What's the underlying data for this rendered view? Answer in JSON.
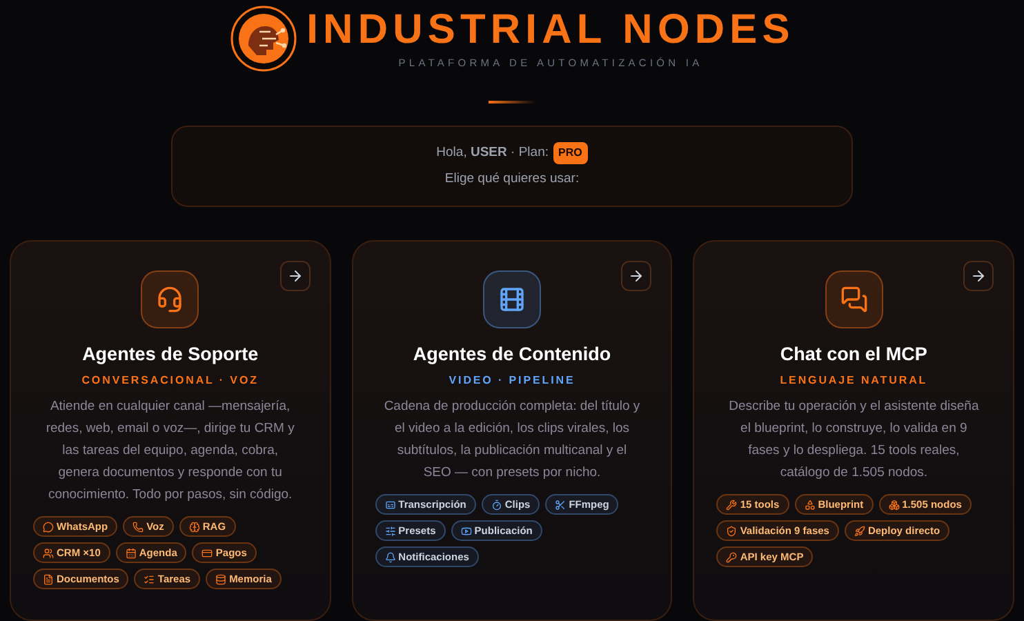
{
  "brand": {
    "title": "INDUSTRIAL NODES",
    "subtitle": "PLATAFORMA DE AUTOMATIZACIÓN IA"
  },
  "welcome": {
    "greeting": "Hola, **USER** · Plan:",
    "plan": "PRO",
    "prompt": "Elige qué quieres usar:"
  },
  "cards": [
    {
      "title": "Agentes de Soporte",
      "subtitle": "CONVERSACIONAL · VOZ",
      "color": "#f97316",
      "description": "Atiende en cualquier canal —mensajería, redes, web, email o voz—, dirige tu CRM y las tareas del equipo, agenda, cobra, genera documentos y responde con tu conocimiento. Todo por pasos, sin código.",
      "tags": [
        "WhatsApp",
        "Voz",
        "RAG",
        "CRM ×10",
        "Agenda",
        "Pagos",
        "Documentos",
        "Tareas",
        "Memoria"
      ]
    },
    {
      "title": "Agentes de Contenido",
      "subtitle": "VIDEO · PIPELINE",
      "color": "#60a5fa",
      "description": "Cadena de producción completa: del título y el video a la edición, los clips virales, los subtítulos, la publicación multicanal y el SEO — con presets por nicho.",
      "tags": [
        "Transcripción",
        "Clips",
        "FFmpeg",
        "Presets",
        "Publicación",
        "Notificaciones"
      ]
    },
    {
      "title": "Chat con el MCP",
      "subtitle": "LENGUAJE NATURAL",
      "color": "#f97316",
      "description": "Describe tu operación y el asistente diseña el blueprint, lo construye, lo valida en 9 fases y lo despliega. 15 tools reales, catálogo de 1.505 nodos.",
      "tags": [
        "15 tools",
        "Blueprint",
        "1.505 nodos",
        "Validación 9 fases",
        "Deploy directo",
        "API key MCP"
      ]
    }
  ]
}
